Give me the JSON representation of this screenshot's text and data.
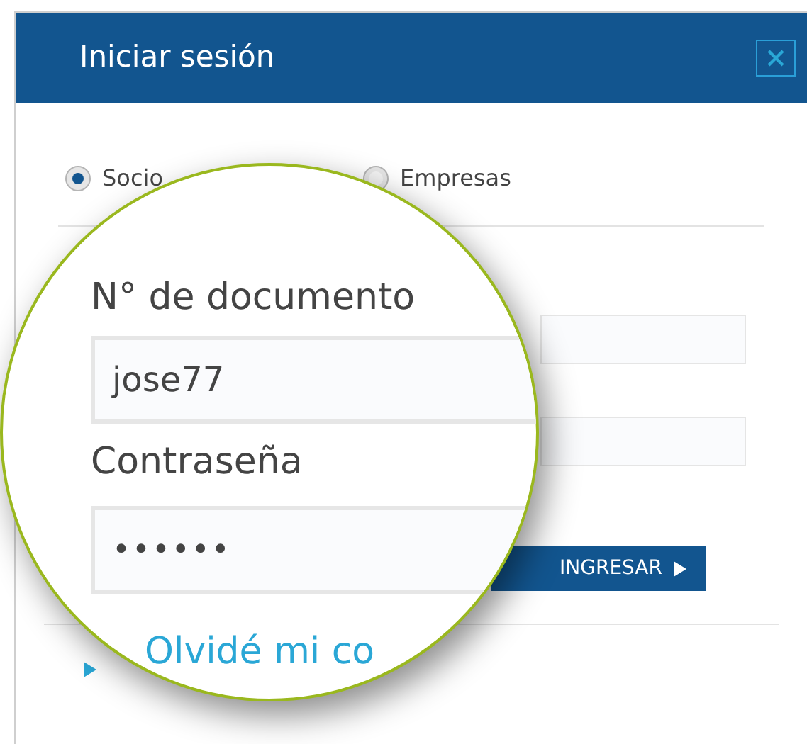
{
  "dialog": {
    "title": "Iniciar sesión"
  },
  "account_types": [
    {
      "label": "Socio",
      "selected": true
    },
    {
      "label": "Empresas",
      "selected": false
    }
  ],
  "magnifier": {
    "fields": [
      {
        "label": "N° de documento",
        "value": "jose77",
        "kind": "text"
      },
      {
        "label": "Contraseña",
        "value": "••••••",
        "kind": "password"
      }
    ],
    "link": "Olvidé mi co"
  },
  "submit": {
    "label": "INGRESAR"
  }
}
